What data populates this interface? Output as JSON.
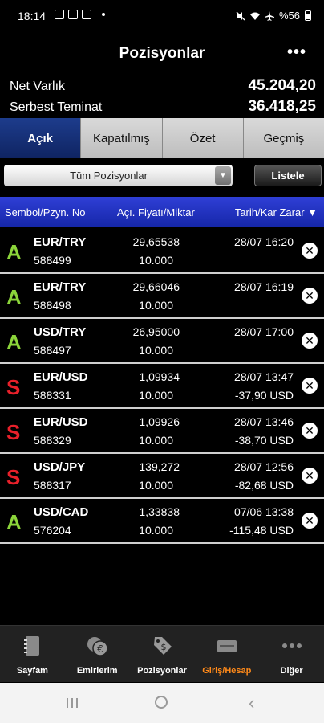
{
  "status_bar": {
    "time": "18:14",
    "icons_left": [
      "gallery-icon",
      "mail-icon",
      "app-icon"
    ],
    "icons_right": [
      "mute-icon",
      "wifi-icon",
      "airplane-icon"
    ],
    "battery": "%56"
  },
  "header": {
    "title": "Pozisyonlar",
    "more": "•••"
  },
  "summary": {
    "net_label": "Net Varlık",
    "net_value": "45.204,20",
    "free_label": "Serbest Teminat",
    "free_value": "36.418,25"
  },
  "tabs": [
    {
      "label": "Açık",
      "active": true
    },
    {
      "label": "Kapatılmış",
      "active": false
    },
    {
      "label": "Özet",
      "active": false
    },
    {
      "label": "Geçmiş",
      "active": false
    }
  ],
  "filter": {
    "selected": "Tüm Pozisyonlar",
    "list_button": "Listele"
  },
  "columns": {
    "c1": "Sembol/Pzyn. No",
    "c2": "Açı. Fiyatı/Miktar",
    "c3": "Tarih/Kar Zarar ▼"
  },
  "positions": [
    {
      "side": "A",
      "symbol": "EUR/TRY",
      "no": "588499",
      "price": "29,65538",
      "qty": "10.000",
      "date": "28/07 16:20",
      "pl": ""
    },
    {
      "side": "A",
      "symbol": "EUR/TRY",
      "no": "588498",
      "price": "29,66046",
      "qty": "10.000",
      "date": "28/07 16:19",
      "pl": ""
    },
    {
      "side": "A",
      "symbol": "USD/TRY",
      "no": "588497",
      "price": "26,95000",
      "qty": "10.000",
      "date": "28/07 17:00",
      "pl": ""
    },
    {
      "side": "S",
      "symbol": "EUR/USD",
      "no": "588331",
      "price": "1,09934",
      "qty": "10.000",
      "date": "28/07 13:47",
      "pl": "-37,90 USD"
    },
    {
      "side": "S",
      "symbol": "EUR/USD",
      "no": "588329",
      "price": "1,09926",
      "qty": "10.000",
      "date": "28/07 13:46",
      "pl": "-38,70 USD"
    },
    {
      "side": "S",
      "symbol": "USD/JPY",
      "no": "588317",
      "price": "139,272",
      "qty": "10.000",
      "date": "28/07 12:56",
      "pl": "-82,68 USD"
    },
    {
      "side": "A",
      "symbol": "USD/CAD",
      "no": "576204",
      "price": "1,33838",
      "qty": "10.000",
      "date": "07/06 13:38",
      "pl": "-115,48 USD"
    }
  ],
  "bottom_nav": [
    {
      "label": "Sayfam",
      "icon": "notebook-icon",
      "active": false
    },
    {
      "label": "Emirlerim",
      "icon": "euro-coins-icon",
      "active": false
    },
    {
      "label": "Pozisyonlar",
      "icon": "tag-dollar-icon",
      "active": false
    },
    {
      "label": "Giriş/Hesap",
      "icon": "card-icon",
      "active": true
    },
    {
      "label": "Diğer",
      "icon": "more-dots-icon",
      "active": false
    }
  ],
  "colors": {
    "buy": "#8bd43a",
    "sell": "#e8202a",
    "tab_active": "#1d3c8c",
    "header_blue": "#2f3fd6",
    "nav_active": "#ff8a1a"
  }
}
